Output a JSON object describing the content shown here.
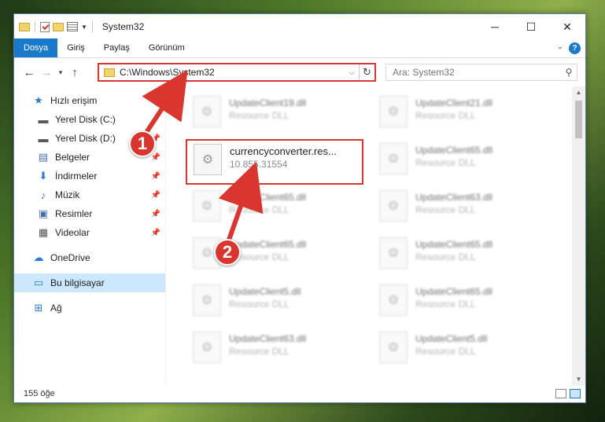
{
  "window": {
    "title": "System32",
    "controls": {
      "minimize": "─",
      "maximize": "☐",
      "close": "✕"
    }
  },
  "ribbon": {
    "tabs": [
      {
        "label": "Dosya",
        "active": true
      },
      {
        "label": "Giriş",
        "active": false
      },
      {
        "label": "Paylaş",
        "active": false
      },
      {
        "label": "Görünüm",
        "active": false
      }
    ],
    "help": "?"
  },
  "address": {
    "path": "C:\\Windows\\System32",
    "search_placeholder": "Ara: System32"
  },
  "sidebar": {
    "items": [
      {
        "label": "Hızlı erişim",
        "icon": "star-icon",
        "glyph": "★",
        "color": "#2a7ad6",
        "level": "top"
      },
      {
        "label": "Yerel Disk (C:)",
        "icon": "drive-icon",
        "glyph": "▬",
        "color": "#5a5a5a",
        "level": "sub",
        "pin": true
      },
      {
        "label": "Yerel Disk (D:)",
        "icon": "drive-icon",
        "glyph": "▬",
        "color": "#5a5a5a",
        "level": "sub",
        "pin": true
      },
      {
        "label": "Belgeler",
        "icon": "document-icon",
        "glyph": "▤",
        "color": "#4a6fa8",
        "level": "sub",
        "pin": true
      },
      {
        "label": "İndirmeler",
        "icon": "download-icon",
        "glyph": "⬇",
        "color": "#2a7ad6",
        "level": "sub",
        "pin": true
      },
      {
        "label": "Müzik",
        "icon": "music-icon",
        "glyph": "♪",
        "color": "#2a7ad6",
        "level": "sub",
        "pin": true
      },
      {
        "label": "Resimler",
        "icon": "pictures-icon",
        "glyph": "▣",
        "color": "#4a6fa8",
        "level": "sub",
        "pin": true
      },
      {
        "label": "Videolar",
        "icon": "video-icon",
        "glyph": "▦",
        "color": "#555",
        "level": "sub",
        "pin": true
      },
      {
        "label": "OneDrive",
        "icon": "cloud-icon",
        "glyph": "☁",
        "color": "#2a7ad6",
        "level": "top",
        "gap": true
      },
      {
        "label": "Bu bilgisayar",
        "icon": "computer-icon",
        "glyph": "▭",
        "color": "#2a7ad6",
        "level": "top",
        "gap": true,
        "selected": true
      },
      {
        "label": "Ağ",
        "icon": "network-icon",
        "glyph": "⊞",
        "color": "#2a7ad6",
        "level": "top",
        "gap": true
      }
    ]
  },
  "files": [
    {
      "name": "UpdateClient19.dll",
      "desc": "Resource DLL",
      "blur": true
    },
    {
      "name": "UpdateClient21.dll",
      "desc": "Resource DLL",
      "blur": true
    },
    {
      "name": "currencyconverter.res...",
      "desc": "10.855.31554",
      "blur": false,
      "highlight": true
    },
    {
      "name": "UpdateClient65.dll",
      "desc": "Resource DLL",
      "blur": true
    },
    {
      "name": "UpdateClient65.dll",
      "desc": "Resource DLL",
      "blur": true
    },
    {
      "name": "UpdateClient63.dll",
      "desc": "Resource DLL",
      "blur": true
    },
    {
      "name": "UpdateClient65.dll",
      "desc": "Resource DLL",
      "blur": true
    },
    {
      "name": "UpdateClient65.dll",
      "desc": "Resource DLL",
      "blur": true
    },
    {
      "name": "UpdateClient5.dll",
      "desc": "Resource DLL",
      "blur": true
    },
    {
      "name": "UpdateClient65.dll",
      "desc": "Resource DLL",
      "blur": true
    },
    {
      "name": "UpdateClient63.dll",
      "desc": "Resource DLL",
      "blur": true
    },
    {
      "name": "UpdateClient5.dll",
      "desc": "Resource DLL",
      "blur": true
    }
  ],
  "status": {
    "count": "155 öğe"
  },
  "annotations": {
    "step1": "1",
    "step2": "2",
    "color": "#d9362f"
  }
}
